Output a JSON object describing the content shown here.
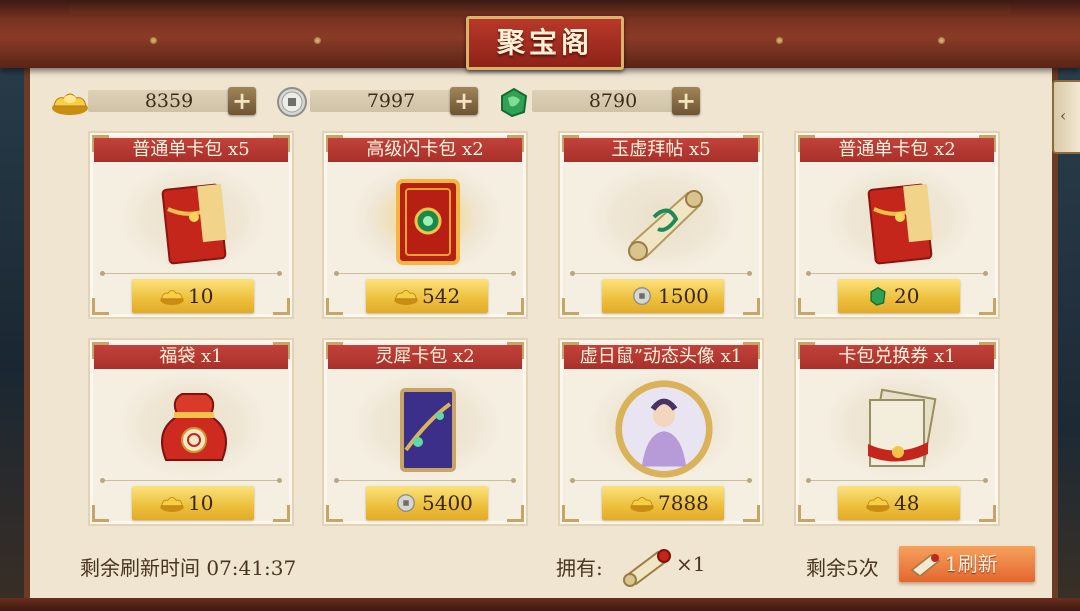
{
  "title": "聚宝阁",
  "currencies": [
    {
      "icon": "gold-ingot-icon",
      "amount": "8359"
    },
    {
      "icon": "silver-coin-icon",
      "amount": "7997"
    },
    {
      "icon": "jade-icon",
      "amount": "8790"
    }
  ],
  "items": [
    {
      "name": "普通单卡包 x5",
      "icon": "red-card-pack-icon",
      "currency": "gold-ingot-icon",
      "price": "10"
    },
    {
      "name": "高级闪卡包 x2",
      "icon": "flash-card-pack-icon",
      "currency": "gold-ingot-icon",
      "price": "542"
    },
    {
      "name": "玉虚拜帖 x5",
      "icon": "scroll-invitation-icon",
      "currency": "silver-coin-icon",
      "price": "1500"
    },
    {
      "name": "普通单卡包 x2",
      "icon": "red-card-pack-icon",
      "currency": "jade-icon",
      "price": "20"
    },
    {
      "name": "福袋 x1",
      "icon": "lucky-bag-icon",
      "currency": "gold-ingot-icon",
      "price": "10"
    },
    {
      "name": "灵犀卡包 x2",
      "icon": "purple-card-pack-icon",
      "currency": "silver-coin-icon",
      "price": "5400"
    },
    {
      "name": "虚日鼠”动态头像 x1",
      "icon": "avatar-frame-icon",
      "currency": "gold-ingot-icon",
      "price": "7888"
    },
    {
      "name": "卡包兑换券 x1",
      "icon": "exchange-voucher-icon",
      "currency": "gold-ingot-icon",
      "price": "48"
    }
  ],
  "footer": {
    "refresh_time_label": "剩余刷新时间 07:41:37",
    "own_label": "拥有:",
    "own_count": "×1",
    "remaining_label": "剩余5次",
    "refresh_button_label": "1刷新"
  },
  "colors": {
    "name_banner": "#b8362e",
    "price_gold": "#f0c548",
    "beam": "#7a3322",
    "panel": "#efe5d1"
  }
}
